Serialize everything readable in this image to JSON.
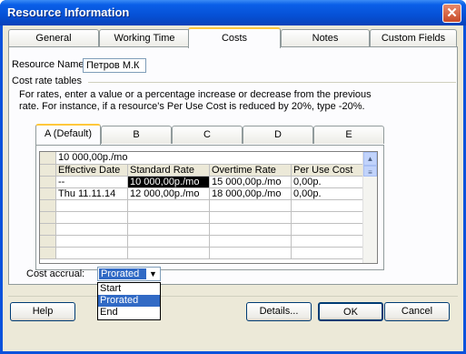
{
  "window": {
    "title": "Resource Information"
  },
  "tabs": [
    {
      "label": "General"
    },
    {
      "label": "Working Time"
    },
    {
      "label": "Costs"
    },
    {
      "label": "Notes"
    },
    {
      "label": "Custom Fields"
    }
  ],
  "active_tab": "Costs",
  "resource_name": {
    "label": "Resource Name:",
    "value": "Петров М.К"
  },
  "cost_rate_tables": {
    "heading": "Cost rate tables",
    "description": "For rates, enter a value or a percentage increase or decrease from the previous rate. For instance, if a resource's Per Use Cost is reduced by 20%, type -20%.",
    "tabs": [
      {
        "label": "A (Default)"
      },
      {
        "label": "B"
      },
      {
        "label": "C"
      },
      {
        "label": "D"
      },
      {
        "label": "E"
      }
    ],
    "edit_bar_value": "10 000,00р./mo",
    "columns": [
      "Effective Date",
      "Standard Rate",
      "Overtime Rate",
      "Per Use Cost"
    ],
    "rows": [
      [
        "--",
        "10 000,00р./mo",
        "15 000,00р./mo",
        "0,00р."
      ],
      [
        "Thu 11.11.14",
        "12 000,00р./mo",
        "18 000,00р./mo",
        "0,00р."
      ]
    ]
  },
  "cost_accrual": {
    "label": "Cost accrual:",
    "selected": "Prorated",
    "options": [
      "Start",
      "Prorated",
      "End"
    ]
  },
  "buttons": {
    "help": "Help",
    "details": "Details...",
    "ok": "OK",
    "cancel": "Cancel"
  },
  "icons": {
    "close": "close-icon",
    "dropdown": "chevron-down-icon",
    "scroll_up": "scroll-up-icon"
  }
}
